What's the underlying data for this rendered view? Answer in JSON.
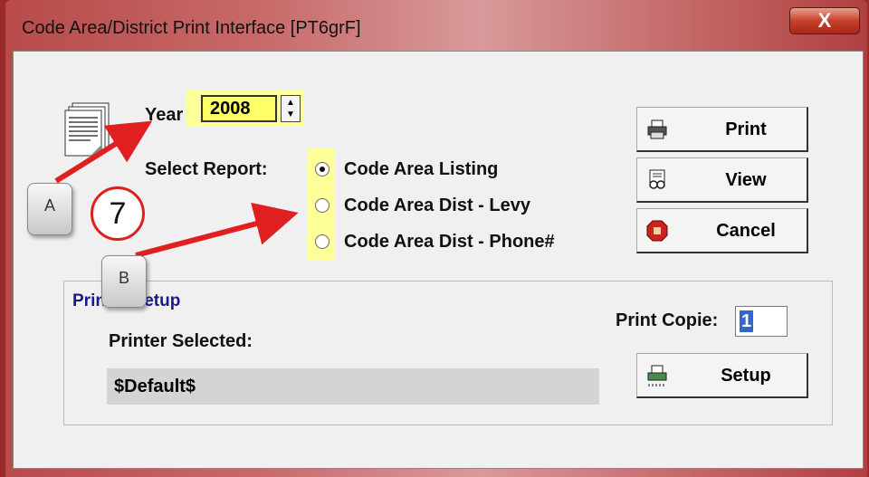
{
  "window": {
    "title": "Code Area/District Print Interface [PT6grF]",
    "close_label": "X"
  },
  "year": {
    "label": "Year",
    "value": "2008"
  },
  "select_report": {
    "label": "Select Report:",
    "options": [
      "Code Area Listing",
      "Code Area Dist - Levy",
      "Code Area Dist - Phone#"
    ],
    "selected_index": 0
  },
  "buttons": {
    "print": "Print",
    "view": "View",
    "cancel": "Cancel",
    "setup": "Setup"
  },
  "printer_setup": {
    "group_title": "Printer Setup",
    "printer_selected_label": "Printer Selected:",
    "printer_value": "$Default$",
    "print_copies_label": "Print Copie:",
    "print_copies_value": "1"
  },
  "annotations": {
    "key_a": "A",
    "key_b": "B",
    "step_number": "7"
  },
  "colors": {
    "highlight": "#ffff99",
    "arrow": "#e02020",
    "group_title": "#1a1a8a"
  },
  "icons": [
    "document-icon",
    "printer-icon",
    "view-icon",
    "stop-icon",
    "setup-printer-icon"
  ]
}
